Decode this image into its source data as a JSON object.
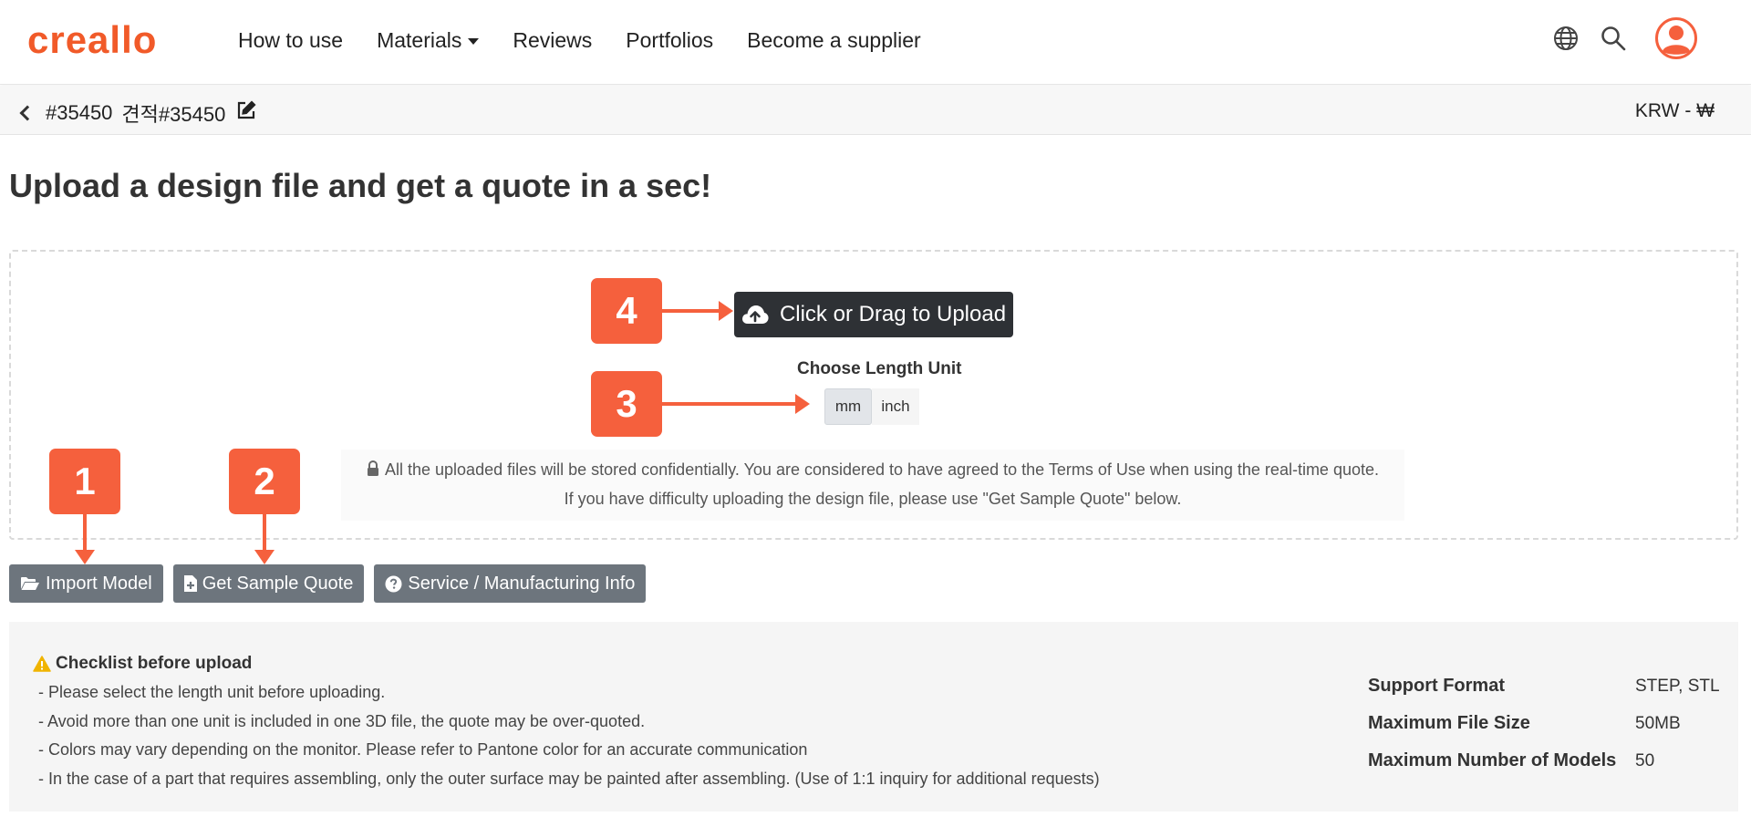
{
  "nav": {
    "logo_text": "creallo",
    "links": [
      "How to use",
      "Materials",
      "Reviews",
      "Portfolios",
      "Become a supplier"
    ],
    "icons": [
      "globe-icon",
      "search-icon",
      "user-avatar-icon"
    ]
  },
  "breadcrumb": {
    "id": "#35450",
    "title": "견적#35450",
    "currency": "KRW - ₩"
  },
  "headline": "Upload a design file and get a quote in a sec!",
  "upload": {
    "button_label": "Click or Drag to Upload",
    "unit_title": "Choose Length Unit",
    "units": [
      "mm",
      "inch"
    ],
    "selected_unit": "mm",
    "notice_line1": "All the uploaded files will be stored confidentially. You are considered to have agreed to the  Terms of Use when using the real-time quote.",
    "notice_line2": "If you have difficulty uploading the design file, please use \"Get Sample Quote\" below."
  },
  "callouts": [
    "1",
    "2",
    "3",
    "4"
  ],
  "actions": {
    "import_label": "Import Model",
    "sample_label": "Get Sample Quote",
    "info_label": "Service / Manufacturing Info"
  },
  "checklist": {
    "title": "Checklist before upload",
    "items": [
      "- Please select the length unit before uploading.",
      "- Avoid more than one unit is included in one 3D file, the quote may be over-quoted.",
      "- Colors may vary depending on the monitor. Please refer to Pantone color for an accurate communication",
      "- In the case of a part that requires assembling, only the outer surface may be painted after assembling. (Use of 1:1 inquiry for additional requests)"
    ]
  },
  "specs": [
    {
      "key": "Support Format",
      "value": "STEP, STL"
    },
    {
      "key": "Maximum File Size",
      "value": "50MB"
    },
    {
      "key": "Maximum Number of Models",
      "value": "50"
    }
  ],
  "colors": {
    "brand": "#f15a29",
    "callout": "#f5603d",
    "dark_button": "#2e3135",
    "gray_button": "#6d757d",
    "warning": "#f0b400"
  }
}
